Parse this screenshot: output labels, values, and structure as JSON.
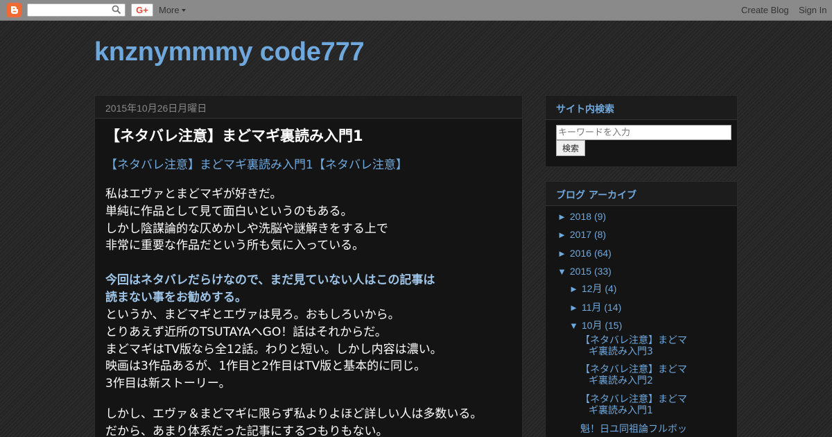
{
  "navbar": {
    "more_label": "More",
    "create_blog": "Create Blog",
    "sign_in": "Sign In",
    "gplus_label": "G+"
  },
  "blog": {
    "title": "knznymmmy code777"
  },
  "post": {
    "date": "2015年10月26日月曜日",
    "title": "【ネタバレ注意】まどマギ裏読み入門1",
    "subtitle": "【ネタバレ注意】まどマギ裏読み入門1【ネタバレ注意】",
    "para1": [
      "私はエヴァとまどマギが好きだ。",
      "単純に作品として見て面白いというのもある。",
      "しかし陰謀論的な仄めかしや洗脳や謎解きをする上で",
      "非常に重要な作品だという所も気に入っている。"
    ],
    "emphasis": [
      "今回はネタバレだらけなので、まだ見ていない人はこの記事は",
      "読まない事をお勧めする。"
    ],
    "para2": [
      "というか、まどマギとエヴァは見ろ。おもしろいから。",
      "とりあえず近所のTSUTAYAへGO！話はそれからだ。",
      "まどマギはTV版なら全12話。わりと短い。しかし内容は濃い。",
      "映画は3作品あるが、1作目と2作目はTV版と基本的に同じ。",
      "3作目は新ストーリー。"
    ],
    "para3": [
      "しかし、エヴァ＆まどマギに限らず私よりよほど詳しい人は多数いる。",
      "だから、あまり体系だった記事にするつもりもない。"
    ]
  },
  "search_widget": {
    "title": "サイト内検索",
    "placeholder": "キーワードを入力",
    "button": "検索"
  },
  "archive_widget": {
    "title": "ブログ アーカイブ",
    "years": [
      {
        "toggle": "►",
        "year": "2018",
        "count": "(9)"
      },
      {
        "toggle": "►",
        "year": "2017",
        "count": "(8)"
      },
      {
        "toggle": "►",
        "year": "2016",
        "count": "(64)"
      },
      {
        "toggle": "▼",
        "year": "2015",
        "count": "(33)"
      }
    ],
    "months": [
      {
        "toggle": "►",
        "month": "12月",
        "count": "(4)"
      },
      {
        "toggle": "►",
        "month": "11月",
        "count": "(14)"
      },
      {
        "toggle": "▼",
        "month": "10月",
        "count": "(15)"
      }
    ],
    "posts": [
      {
        "line1": "【ネタバレ注意】まどマ",
        "line2": "ギ裏読み入門3"
      },
      {
        "line1": "【ネタバレ注意】まどマ",
        "line2": "ギ裏読み入門2"
      },
      {
        "line1": "【ネタバレ注意】まどマ",
        "line2": "ギ裏読み入門1"
      },
      {
        "line1": "魁！日ユ同祖論フルボッ",
        "line2": ""
      }
    ]
  }
}
